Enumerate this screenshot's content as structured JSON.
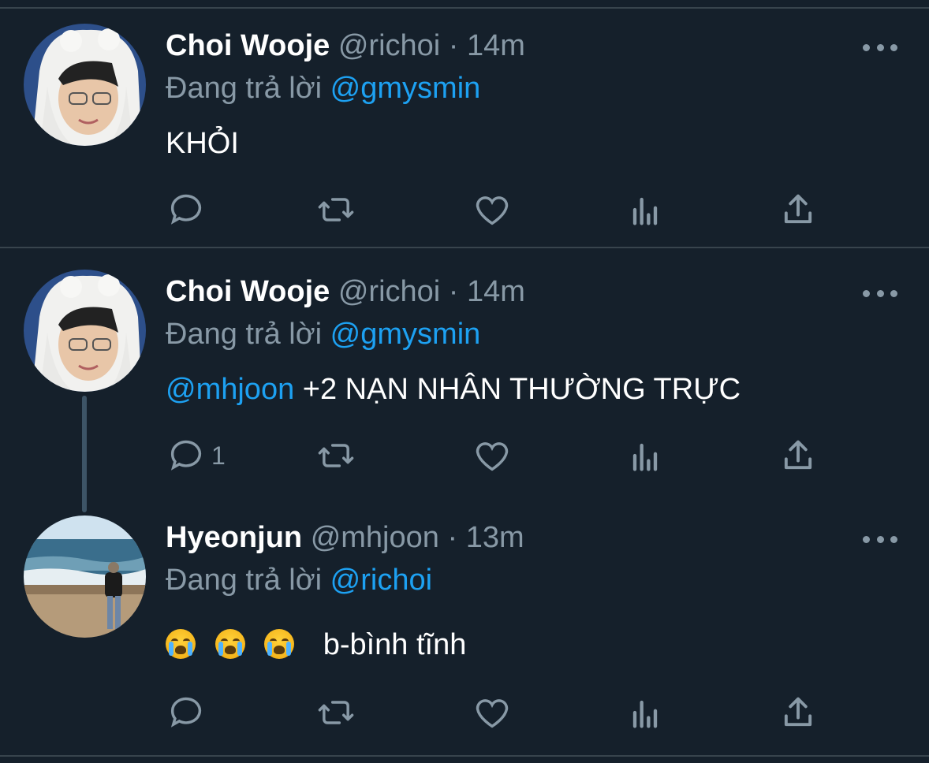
{
  "reply_label": "Đang trả lời",
  "dot": "·",
  "tweets": [
    {
      "name": "Choi Wooje",
      "handle": "@richoi",
      "time": "14m",
      "reply_to": "@gmysmin",
      "text_mention": "",
      "text": "KHỎI",
      "reply_count": ""
    },
    {
      "name": "Choi Wooje",
      "handle": "@richoi",
      "time": "14m",
      "reply_to": "@gmysmin",
      "text_mention": "@mhjoon",
      "text": " +2 NẠN NHÂN THƯỜNG TRỰC",
      "reply_count": "1"
    },
    {
      "name": "Hyeonjun",
      "handle": "@mhjoon",
      "time": "13m",
      "reply_to": "@richoi",
      "text_mention": "",
      "text": "b-bình tĩnh",
      "reply_count": "",
      "emoji": [
        "loudly-crying-face",
        "loudly-crying-face",
        "loudly-crying-face"
      ]
    }
  ],
  "colors": {
    "background": "#15202b",
    "muted": "#8899a6",
    "accent": "#1da1f2",
    "divider": "#38444d"
  }
}
